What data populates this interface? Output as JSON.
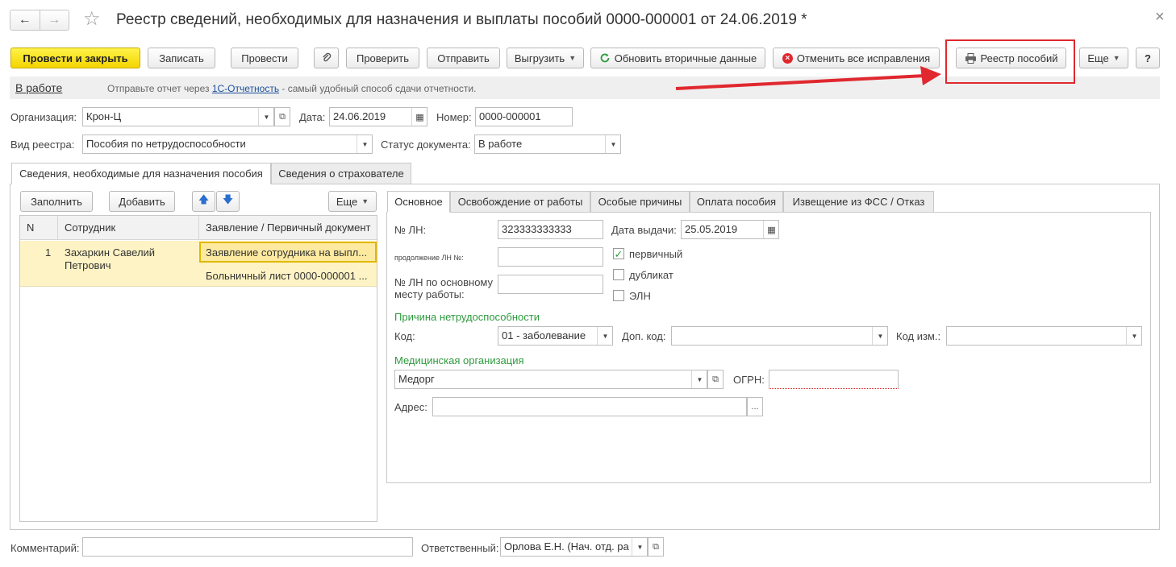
{
  "window": {
    "title": "Реестр сведений, необходимых для назначения и выплаты пособий 0000-000001 от 24.06.2019 *",
    "close_glyph": "×"
  },
  "nav": {
    "back_glyph": "←",
    "forward_glyph": "→",
    "star_glyph": "☆"
  },
  "toolbar": {
    "post_close": "Провести и закрыть",
    "save": "Записать",
    "post": "Провести",
    "check": "Проверить",
    "send": "Отправить",
    "upload": "Выгрузить",
    "refresh_secondary": "Обновить вторичные данные",
    "cancel_corrections": "Отменить все исправления",
    "benefits_register": "Реестр пособий",
    "more": "Еще",
    "help": "?"
  },
  "status_bar": {
    "status_link": "В работе",
    "hint_prefix": "Отправьте отчет через ",
    "hint_link": "1С-Отчетность",
    "hint_suffix": " - самый удобный способ сдачи отчетности."
  },
  "form": {
    "organization_label": "Организация:",
    "organization_value": "Крон-Ц",
    "date_label": "Дата:",
    "date_value": "24.06.2019",
    "number_label": "Номер:",
    "number_value": "0000-000001",
    "register_type_label": "Вид реестра:",
    "register_type_value": "Пособия по нетрудоспособности",
    "doc_status_label": "Статус документа:",
    "doc_status_value": "В работе"
  },
  "outer_tabs": [
    "Сведения, необходимые для назначения пособия",
    "Сведения о страхователе"
  ],
  "left_panel": {
    "fill": "Заполнить",
    "add": "Добавить",
    "more": "Еще",
    "columns": [
      "N",
      "Сотрудник",
      "Заявление / Первичный документ"
    ],
    "rows": [
      {
        "n": "1",
        "employee_line1": "Захаркин Савелий",
        "employee_line2": "Петрович",
        "doc1": "Заявление сотрудника на выпл...",
        "doc2": "Больничный лист 0000-000001 ..."
      }
    ]
  },
  "inner_tabs": [
    "Основное",
    "Освобождение от работы",
    "Особые причины",
    "Оплата пособия",
    "Извещение из ФСС / Отказ"
  ],
  "details": {
    "ln_label": "№ ЛН:",
    "ln_value": "323333333333",
    "issue_date_label": "Дата выдачи:",
    "issue_date_value": "25.05.2019",
    "continuation_label": "продолжение ЛН №:",
    "continuation_value": "",
    "main_job_ln_label_1": "№ ЛН по основному",
    "main_job_ln_label_2": "месту работы:",
    "main_job_ln_value": "",
    "primary_label": "первичный",
    "primary_checked": "✓",
    "duplicate_label": "дубликат",
    "eln_label": "ЭЛН",
    "cause_header": "Причина нетрудоспособности",
    "code_label": "Код:",
    "code_value": "01 - заболевание",
    "extra_code_label": "Доп. код:",
    "extra_code_value": "",
    "change_code_label": "Код изм.:",
    "change_code_value": "",
    "med_org_header": "Медицинская организация",
    "med_org_value": "Медорг",
    "ogrn_label": "ОГРН:",
    "ogrn_value": "",
    "address_label": "Адрес:",
    "address_value": "",
    "address_btn": "..."
  },
  "footer": {
    "comment_label": "Комментарий:",
    "comment_value": "",
    "responsible_label": "Ответственный:",
    "responsible_value": "Орлова Е.Н. (Нач. отд. ра"
  },
  "colors": {
    "highlight_box": "#e0282e",
    "arrow": "#e0282e",
    "section_header": "#2e9a3e",
    "row_selected": "#fdf3c4",
    "link": "#1a4f9c"
  }
}
